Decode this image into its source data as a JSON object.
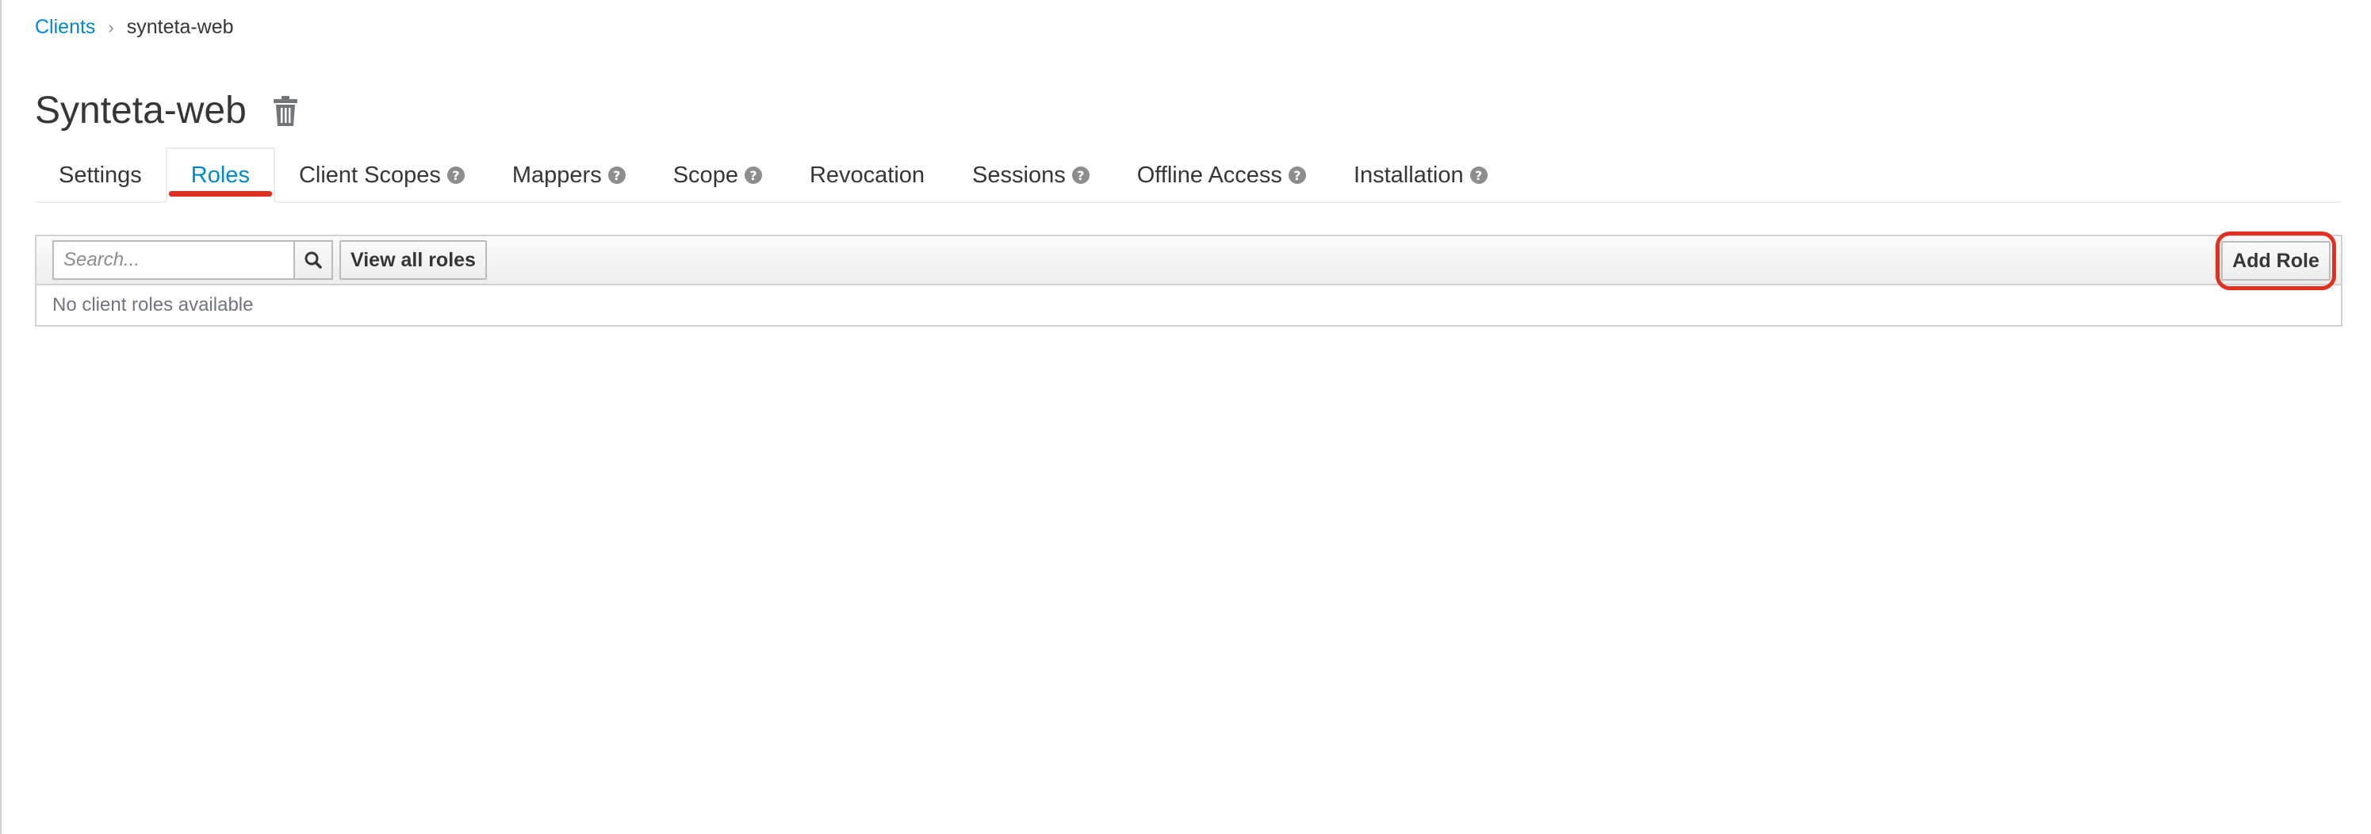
{
  "breadcrumb": {
    "parent": "Clients",
    "separator": "›",
    "current": "synteta-web"
  },
  "page": {
    "title": "Synteta-web",
    "delete_icon": "trash-icon"
  },
  "tabs": [
    {
      "label": "Settings",
      "help": false,
      "active": false
    },
    {
      "label": "Roles",
      "help": false,
      "active": true
    },
    {
      "label": "Client Scopes",
      "help": true,
      "active": false
    },
    {
      "label": "Mappers",
      "help": true,
      "active": false
    },
    {
      "label": "Scope",
      "help": true,
      "active": false
    },
    {
      "label": "Revocation",
      "help": false,
      "active": false
    },
    {
      "label": "Sessions",
      "help": true,
      "active": false
    },
    {
      "label": "Offline Access",
      "help": true,
      "active": false
    },
    {
      "label": "Installation",
      "help": true,
      "active": false
    }
  ],
  "help_glyph": "?",
  "toolbar": {
    "search_placeholder": "Search...",
    "search_value": "",
    "view_all_label": "View all roles",
    "add_role_label": "Add Role"
  },
  "table": {
    "empty_text": "No client roles available"
  },
  "colors": {
    "link": "#0088ce",
    "highlight": "#e0301e",
    "border": "#d1d1d1"
  }
}
